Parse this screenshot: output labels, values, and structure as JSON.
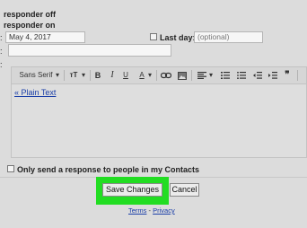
{
  "responder": {
    "option_off_label": "responder off",
    "option_on_label": "responder on",
    "first_day_value": "May 4, 2017",
    "last_day_label": "Last day:",
    "last_day_value": "(optional)",
    "field_colon": ":",
    "subject_value": ""
  },
  "toolbar": {
    "font_label": "Sans Serif",
    "font_arrow": "▾",
    "size_label": "тT",
    "size_arrow": "▾",
    "bold_label": "B",
    "italic_label": "I",
    "underline_label": "U",
    "color_label": "A",
    "color_arrow": "▾",
    "align_arrow": "▾",
    "quote_label": "❞"
  },
  "editor": {
    "plain_text_link": "« Plain Text",
    "body_value": ""
  },
  "contacts": {
    "only_contacts_label": "Only send a response to people in my Contacts"
  },
  "actions": {
    "save_label": "Save Changes",
    "cancel_label": "Cancel",
    "highlight_color": "#22dd22"
  },
  "footer": {
    "terms_label": "Terms",
    "separator": "-",
    "privacy_label": "Privacy"
  }
}
